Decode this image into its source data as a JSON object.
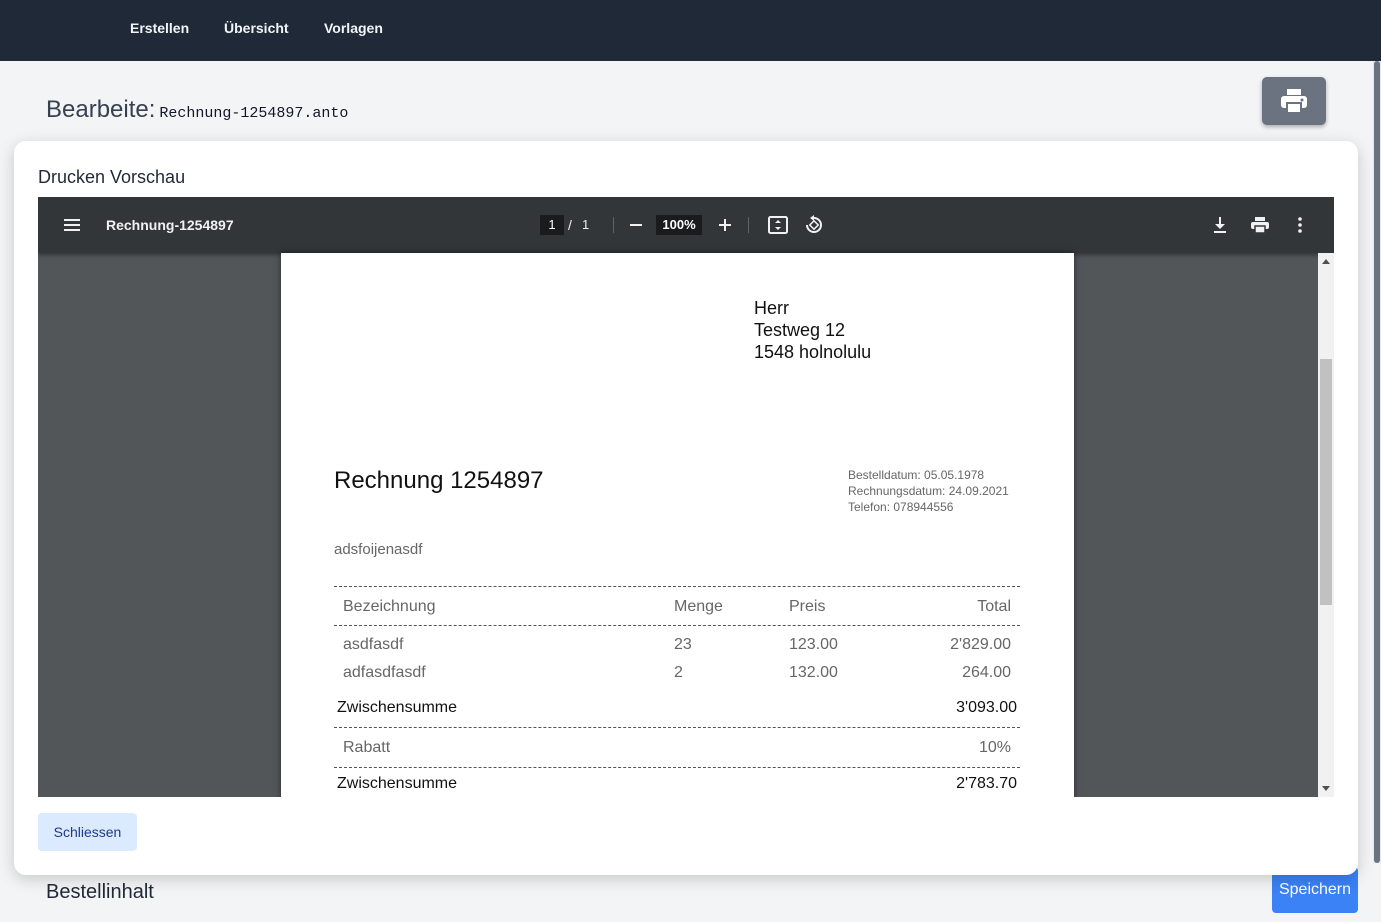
{
  "nav": {
    "items": [
      "Erstellen",
      "Übersicht",
      "Vorlagen"
    ]
  },
  "page": {
    "edit_label": "Bearbeite:",
    "filename": "Rechnung-1254897.anto",
    "print_icon": "printer-icon",
    "section_label": "Bestellinhalt",
    "save_label": "Speichern"
  },
  "modal": {
    "title": "Drucken Vorschau",
    "close_label": "Schliessen"
  },
  "viewer": {
    "doc_title": "Rechnung-1254897",
    "current_page": "1",
    "page_separator": "/",
    "total_pages": "1",
    "zoom": "100%",
    "icons": [
      "menu-icon",
      "zoom-out-icon",
      "zoom-in-icon",
      "fit-page-icon",
      "rotate-icon",
      "download-icon",
      "print-icon",
      "more-vert-icon"
    ]
  },
  "invoice": {
    "address": [
      "Herr",
      "Testweg 12",
      "1548 holnolulu"
    ],
    "title": "Rechnung 1254897",
    "meta": {
      "order_date": "Bestelldatum: 05.05.1978",
      "invoice_date": "Rechnungsdatum: 24.09.2021",
      "phone": "Telefon: 078944556"
    },
    "description": "adsfoijenasdf",
    "headers": {
      "name": "Bezeichnung",
      "qty": "Menge",
      "price": "Preis",
      "total": "Total"
    },
    "rows": [
      {
        "name": "asdfasdf",
        "qty": "23",
        "price": "123.00",
        "total": "2'829.00"
      },
      {
        "name": "adfasdfasdf",
        "qty": "2",
        "price": "132.00",
        "total": "264.00"
      }
    ],
    "subtotal1": {
      "label": "Zwischensumme",
      "value": "3'093.00"
    },
    "discount": {
      "label": "Rabatt",
      "value": "10%"
    },
    "subtotal2": {
      "label": "Zwischensumme",
      "value": "2'783.70"
    }
  },
  "colors": {
    "nav_bg": "#1f2937",
    "viewer_toolbar": "#323639",
    "viewer_bg": "#525659",
    "save_button": "#3b82f6",
    "close_button_bg": "#dbeafe"
  }
}
